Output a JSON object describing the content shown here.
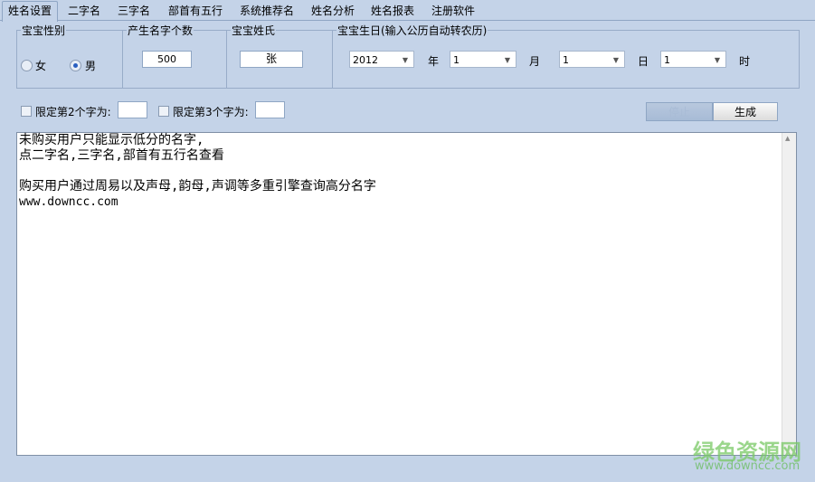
{
  "tabs": [
    "姓名设置",
    "二字名",
    "三字名",
    "部首有五行",
    "系统推荐名",
    "姓名分析",
    "姓名报表",
    "注册软件"
  ],
  "gender": {
    "title": "宝宝性别",
    "female": "女",
    "male": "男",
    "selected": "男"
  },
  "count": {
    "title": "产生名字个数",
    "value": "500"
  },
  "surname": {
    "title": "宝宝姓氏",
    "value": "张"
  },
  "birthday": {
    "title": "宝宝生日(输入公历自动转农历)",
    "year": "2012",
    "year_unit": "年",
    "month": "1",
    "month_unit": "月",
    "day": "1",
    "day_unit": "日",
    "hour": "1",
    "hour_unit": "时"
  },
  "limit2": {
    "label": "限定第2个字为:",
    "value": ""
  },
  "limit3": {
    "label": "限定第3个字为:",
    "value": ""
  },
  "buttons": {
    "stop": "停止",
    "generate": "生成"
  },
  "output": {
    "lines": [
      "未购买用户只能显示低分的名字,",
      "点二字名,三字名,部首有五行名查看",
      "",
      "购买用户通过周易以及声母,韵母,声调等多重引擎查询高分名字",
      "www.downcc.com"
    ]
  },
  "watermark": {
    "name": "绿色资源网",
    "url": "www.downcc.com"
  }
}
